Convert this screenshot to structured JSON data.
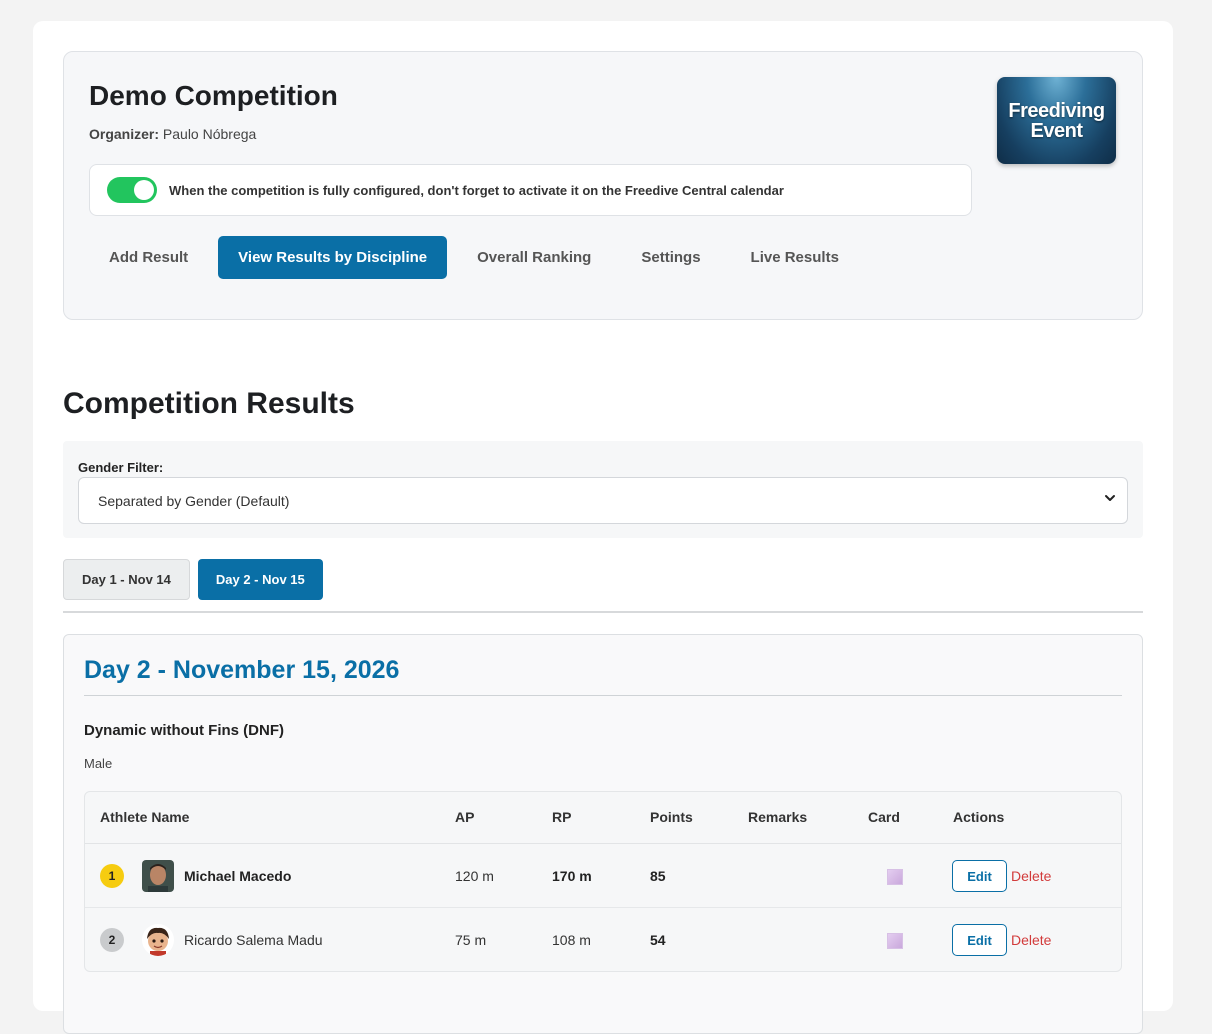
{
  "header": {
    "title": "Demo Competition",
    "organizer_label": "Organizer:",
    "organizer_name": "Paulo Nóbrega",
    "logo_line1": "Freediving",
    "logo_line2": "Event",
    "notice": "When the competition is fully configured, don't forget to activate it on the Freedive Central calendar",
    "toggle_on": true
  },
  "tabs": [
    {
      "label": "Add Result",
      "active": false
    },
    {
      "label": "View Results by Discipline",
      "active": true
    },
    {
      "label": "Overall Ranking",
      "active": false
    },
    {
      "label": "Settings",
      "active": false
    },
    {
      "label": "Live Results",
      "active": false
    }
  ],
  "results": {
    "title": "Competition Results",
    "filter_label": "Gender Filter:",
    "filter_value": "Separated by Gender (Default)"
  },
  "day_tabs": [
    {
      "label": "Day 1 - Nov 14",
      "active": false
    },
    {
      "label": "Day 2 - Nov 15",
      "active": true
    }
  ],
  "day": {
    "title": "Day 2 - November 15, 2026",
    "discipline": "Dynamic without Fins (DNF)",
    "gender": "Male"
  },
  "table": {
    "headers": [
      "Athlete Name",
      "AP",
      "RP",
      "Points",
      "Remarks",
      "Card",
      "Actions"
    ],
    "rows": [
      {
        "rank": "1",
        "name": "Michael Macedo",
        "ap": "120 m",
        "rp": "170 m",
        "points": "85",
        "remarks": "",
        "edit": "Edit",
        "delete": "Delete"
      },
      {
        "rank": "2",
        "name": "Ricardo Salema Madu",
        "ap": "75 m",
        "rp": "108 m",
        "points": "54",
        "remarks": "",
        "edit": "Edit",
        "delete": "Delete"
      }
    ]
  },
  "colors": {
    "accent": "#0a6fa6",
    "toggle": "#22c55e",
    "danger": "#d23b3b",
    "gold": "#f6cc10",
    "silver": "#c9cbcd"
  }
}
